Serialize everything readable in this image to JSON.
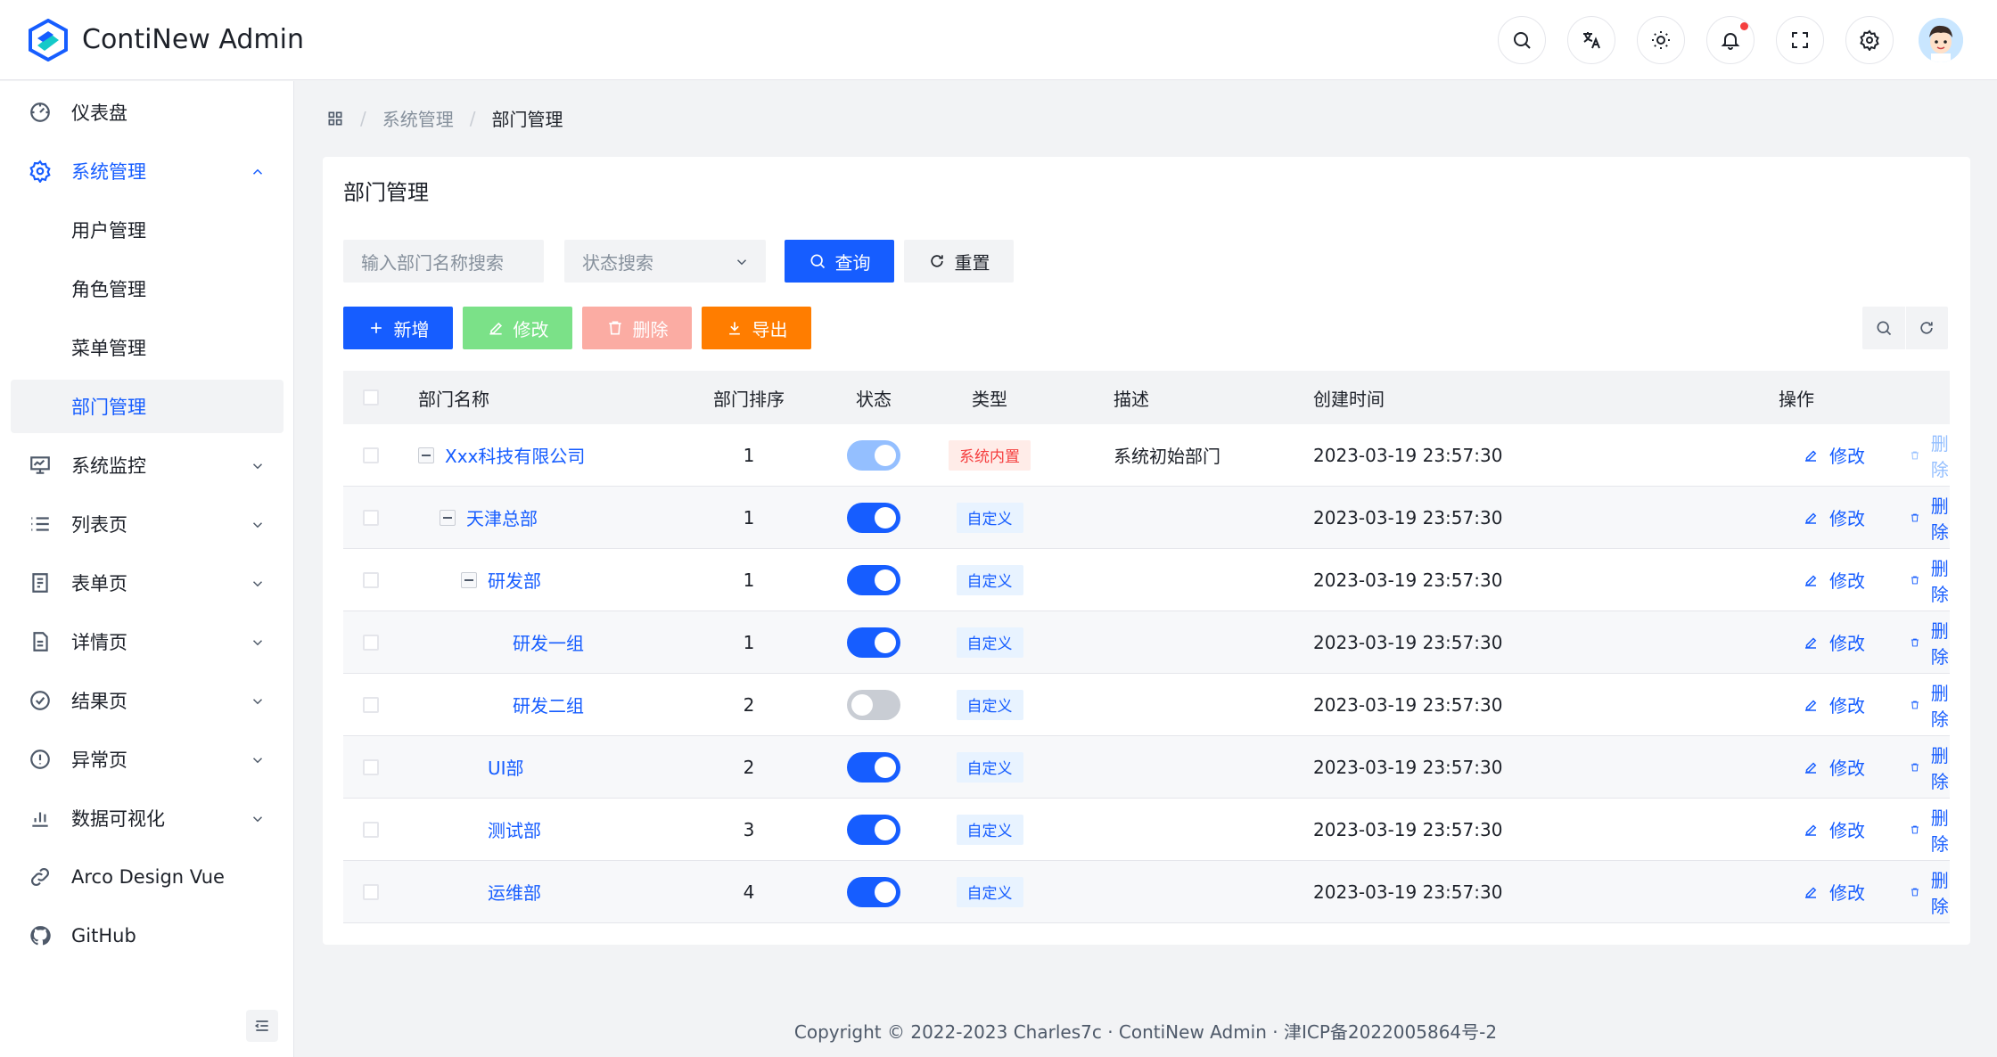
{
  "app": {
    "title": "ContiNew Admin"
  },
  "header": {
    "icons": [
      "search-icon",
      "translate-icon",
      "theme-icon",
      "bell-icon",
      "fullscreen-icon",
      "settings-icon"
    ],
    "notification_dot": true
  },
  "sidebar": {
    "items": [
      {
        "label": "仪表盘",
        "icon": "dashboard-icon"
      },
      {
        "label": "系统管理",
        "icon": "settings-icon",
        "expanded": true
      },
      {
        "label": "用户管理"
      },
      {
        "label": "角色管理"
      },
      {
        "label": "菜单管理"
      },
      {
        "label": "部门管理",
        "selected": true
      },
      {
        "label": "系统监控",
        "icon": "monitor-icon"
      },
      {
        "label": "列表页",
        "icon": "list-icon"
      },
      {
        "label": "表单页",
        "icon": "form-icon"
      },
      {
        "label": "详情页",
        "icon": "file-icon"
      },
      {
        "label": "结果页",
        "icon": "check-circle-icon"
      },
      {
        "label": "异常页",
        "icon": "exclamation-icon"
      },
      {
        "label": "数据可视化",
        "icon": "bar-chart-icon"
      },
      {
        "label": "Arco Design Vue",
        "icon": "link-icon"
      },
      {
        "label": "GitHub",
        "icon": "github-icon"
      }
    ]
  },
  "breadcrumb": {
    "items": [
      "系统管理",
      "部门管理"
    ]
  },
  "page": {
    "title": "部门管理",
    "search": {
      "name_placeholder": "输入部门名称搜索",
      "status_placeholder": "状态搜索"
    },
    "buttons": {
      "query": "查询",
      "reset": "重置",
      "add": "新增",
      "edit": "修改",
      "delete": "删除",
      "export": "导出"
    }
  },
  "table": {
    "columns": [
      "部门名称",
      "部门排序",
      "状态",
      "类型",
      "描述",
      "创建时间",
      "操作"
    ],
    "rows": [
      {
        "name": "Xxx科技有限公司",
        "sort": "1",
        "status": "on-disabled",
        "type": "系统内置",
        "type_color": "red",
        "desc": "系统初始部门",
        "created": "2023-03-19 23:57:30",
        "edit": "修改",
        "del": "删除",
        "del_disabled": true,
        "level": 0,
        "expanded": true
      },
      {
        "name": "天津总部",
        "sort": "1",
        "status": "on",
        "type": "自定义",
        "type_color": "blue",
        "desc": "",
        "created": "2023-03-19 23:57:30",
        "edit": "修改",
        "del": "删除",
        "del_disabled": false,
        "level": 1,
        "expanded": true
      },
      {
        "name": "研发部",
        "sort": "1",
        "status": "on",
        "type": "自定义",
        "type_color": "blue",
        "desc": "",
        "created": "2023-03-19 23:57:30",
        "edit": "修改",
        "del": "删除",
        "del_disabled": false,
        "level": 2,
        "expanded": true
      },
      {
        "name": "研发一组",
        "sort": "1",
        "status": "on",
        "type": "自定义",
        "type_color": "blue",
        "desc": "",
        "created": "2023-03-19 23:57:30",
        "edit": "修改",
        "del": "删除",
        "del_disabled": false,
        "level": 3
      },
      {
        "name": "研发二组",
        "sort": "2",
        "status": "off",
        "type": "自定义",
        "type_color": "blue",
        "desc": "",
        "created": "2023-03-19 23:57:30",
        "edit": "修改",
        "del": "删除",
        "del_disabled": false,
        "level": 3
      },
      {
        "name": "UI部",
        "sort": "2",
        "status": "on",
        "type": "自定义",
        "type_color": "blue",
        "desc": "",
        "created": "2023-03-19 23:57:30",
        "edit": "修改",
        "del": "删除",
        "del_disabled": false,
        "level": 2
      },
      {
        "name": "测试部",
        "sort": "3",
        "status": "on",
        "type": "自定义",
        "type_color": "blue",
        "desc": "",
        "created": "2023-03-19 23:57:30",
        "edit": "修改",
        "del": "删除",
        "del_disabled": false,
        "level": 2
      },
      {
        "name": "运维部",
        "sort": "4",
        "status": "on",
        "type": "自定义",
        "type_color": "blue",
        "desc": "",
        "created": "2023-03-19 23:57:30",
        "edit": "修改",
        "del": "删除",
        "del_disabled": false,
        "level": 2
      }
    ]
  },
  "footer": {
    "text": "Copyright © 2022-2023 Charles7c · ContiNew Admin · 津ICP备2022005864号-2"
  },
  "colors": {
    "primary": "#165dff",
    "danger": "#f53f3f",
    "success": "#7be188",
    "warning": "#ff7d00"
  }
}
